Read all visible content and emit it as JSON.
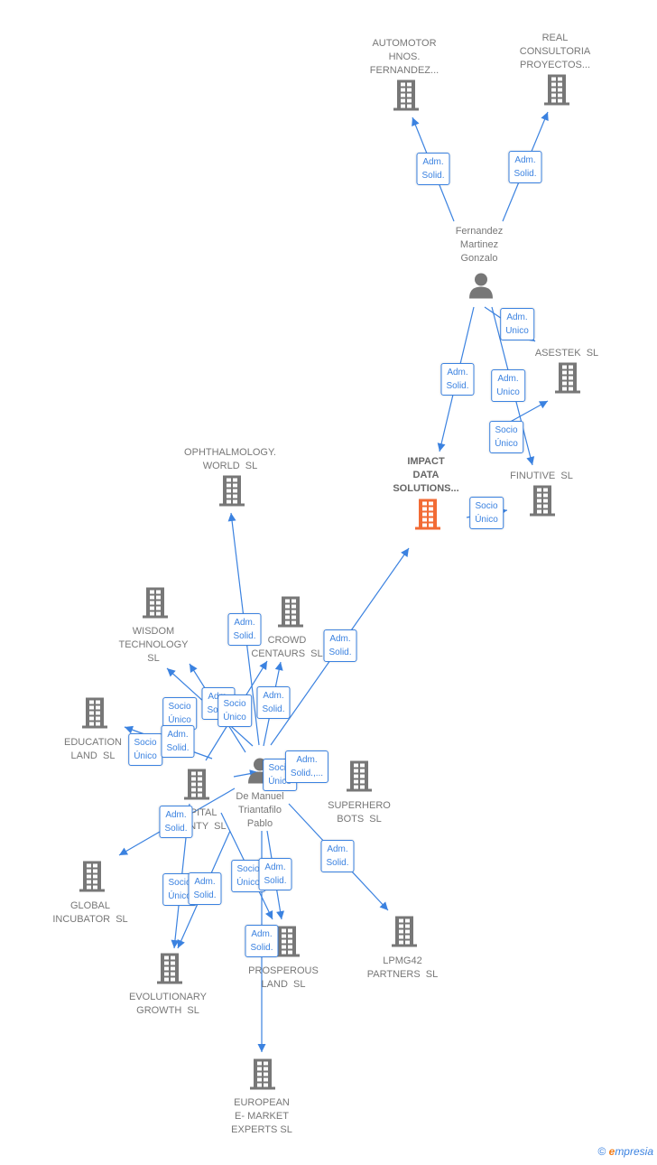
{
  "colors": {
    "edge": "#3b82e0",
    "icon": "#777777",
    "main_node": "#f26b35"
  },
  "nodes": [
    {
      "id": "automotor",
      "type": "company",
      "label": "AUTOMOTOR\nHNOS.\nFERNANDEZ..."
    },
    {
      "id": "real",
      "type": "company",
      "label": "REAL\nCONSULTORIA\nPROYECTOS..."
    },
    {
      "id": "fernandez",
      "type": "person",
      "label": "Fernandez\nMartinez\nGonzalo"
    },
    {
      "id": "asestek",
      "type": "company",
      "label": "ASESTEK  SL"
    },
    {
      "id": "impact",
      "type": "company-main",
      "label": "IMPACT\nDATA\nSOLUTIONS..."
    },
    {
      "id": "finutive",
      "type": "company",
      "label": "FINUTIVE  SL"
    },
    {
      "id": "ophthalmology",
      "type": "company",
      "label": "OPHTHALMOLOGY.\nWORLD  SL"
    },
    {
      "id": "wisdom",
      "type": "company",
      "label": "WISDOM\nTECHNOLOGY\nSL"
    },
    {
      "id": "crowd",
      "type": "company",
      "label": "CROWD\nCENTAURS  SL"
    },
    {
      "id": "education",
      "type": "company",
      "label": "EDUCATION\nLAND  SL"
    },
    {
      "id": "capital",
      "type": "company",
      "label": "CAPITAL\nBOUNTY  SL"
    },
    {
      "id": "demanuel",
      "type": "person",
      "label": "De Manuel\nTriantafilo\nPablo"
    },
    {
      "id": "superhero",
      "type": "company",
      "label": "SUPERHERO\nBOTS  SL"
    },
    {
      "id": "global",
      "type": "company",
      "label": "GLOBAL\nINCUBATOR  SL"
    },
    {
      "id": "evolutionary",
      "type": "company",
      "label": "EVOLUTIONARY\nGROWTH  SL"
    },
    {
      "id": "prosperous",
      "type": "company",
      "label": "PROSPEROUS\nLAND  SL"
    },
    {
      "id": "lpmg42",
      "type": "company",
      "label": "LPMG42\nPARTNERS  SL"
    },
    {
      "id": "european",
      "type": "company",
      "label": "EUROPEAN\nE- MARKET\nEXPERTS SL"
    }
  ],
  "edge_labels": [
    "Adm.\nSolid.",
    "Adm.\nSolid.",
    "Adm.\nUnico",
    "Adm.\nSolid.",
    "Adm.\nUnico",
    "Socio\nÚnico",
    "Socio\nÚnico",
    "Adm.\nSolid.",
    "Adm.\nSolid.",
    "Socio\nÚnico",
    "Adm.\nSolid.",
    "Socio\nÚnico",
    "Adm.\nSolid.",
    "Socio\nÚnico",
    "Adm.\nSolid.",
    "Socio\nÚnico",
    "Adm.\nSolid.,...",
    "Adm.\nSolid.",
    "Adm.\nSolid.",
    "Socio\nÚnico",
    "Adm.\nSolid.",
    "Socio\nÚnico",
    "Adm.\nSolid.",
    "Adm.\nSolid."
  ],
  "brand": {
    "copyright": "©",
    "e": "e",
    "rest": "mpresia"
  }
}
